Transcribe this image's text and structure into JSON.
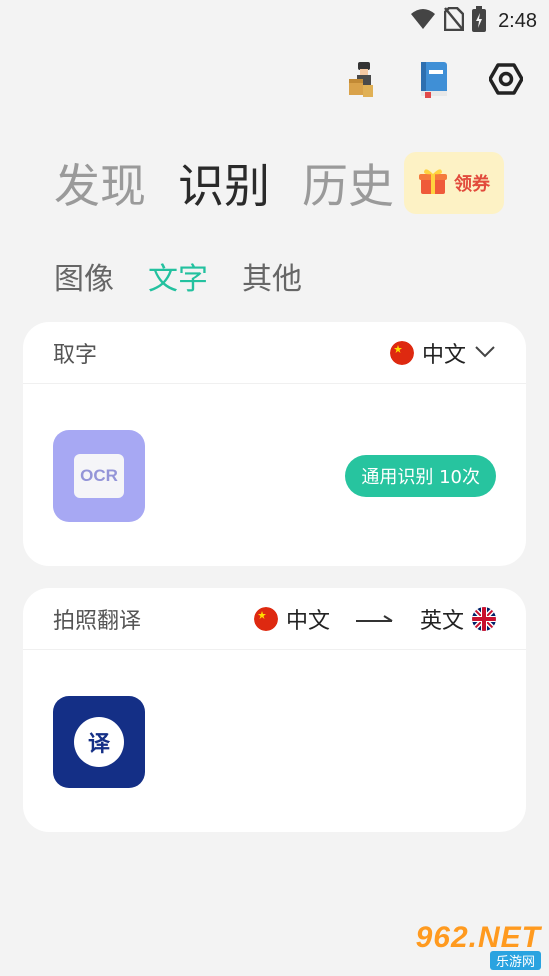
{
  "status": {
    "time": "2:48"
  },
  "main_tabs": [
    {
      "label": "发现"
    },
    {
      "label": "识别"
    },
    {
      "label": "历史"
    }
  ],
  "coupon": {
    "label": "领券"
  },
  "sub_tabs": [
    {
      "label": "图像"
    },
    {
      "label": "文字"
    },
    {
      "label": "其他"
    }
  ],
  "ocr_card": {
    "title": "取字",
    "language": "中文",
    "tile_text": "OCR",
    "usage": "通用识别 10次"
  },
  "translate_card": {
    "title": "拍照翻译",
    "source_language": "中文",
    "target_language": "英文",
    "tile_text": "译"
  },
  "watermark": {
    "top": "962.NET",
    "bottom": "乐游网"
  },
  "colors": {
    "accent": "#23c19f",
    "ocr_tile": "#a7a8f3",
    "translate_tile": "#142f86",
    "coupon_bg": "#fdf2c5"
  }
}
